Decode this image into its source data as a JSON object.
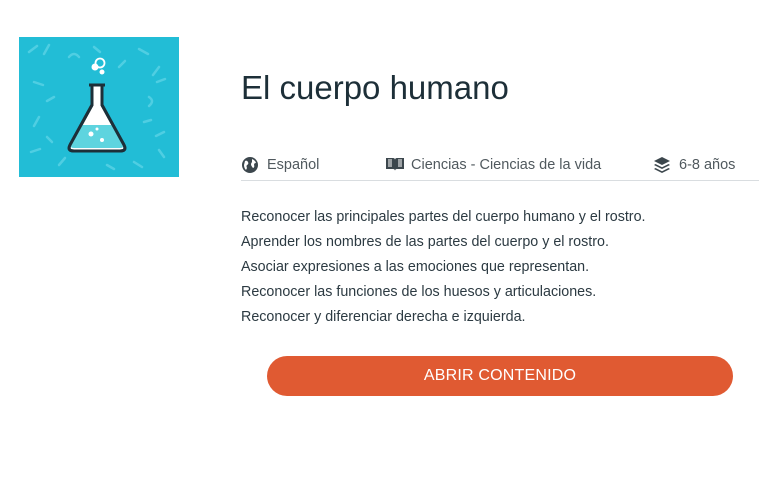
{
  "course": {
    "title": "El cuerpo humano",
    "thumbnail_icon": "flask-icon",
    "thumbnail_color": "#22bdd6"
  },
  "meta": {
    "language": "Español",
    "subject": "Ciencias - Ciencias de la vida",
    "age": "6-8 años"
  },
  "objectives": [
    "Reconocer las principales partes del cuerpo humano y el rostro.",
    "Aprender los nombres de las partes del cuerpo y el rostro.",
    "Asociar expresiones a las emociones que representan.",
    "Reconocer las funciones de los huesos y articulaciones.",
    "Reconocer y diferenciar derecha e izquierda."
  ],
  "actions": {
    "open_label": "ABRIR CONTENIDO",
    "accent_color": "#e05a32"
  }
}
